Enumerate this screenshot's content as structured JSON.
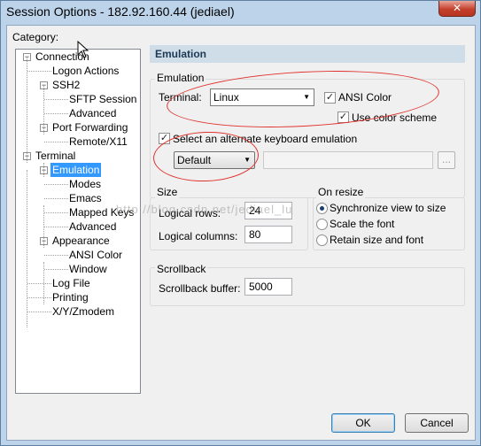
{
  "window": {
    "title": "Session Options - 182.92.160.44 (jediael)",
    "close_glyph": "✕"
  },
  "category_label": "Category:",
  "tree": [
    {
      "label": "Connection",
      "expander": "−"
    },
    {
      "label": "Logon Actions"
    },
    {
      "label": "SSH2",
      "expander": "−"
    },
    {
      "label": "SFTP Session"
    },
    {
      "label": "Advanced"
    },
    {
      "label": "Port Forwarding",
      "expander": "−"
    },
    {
      "label": "Remote/X11"
    },
    {
      "label": "Terminal",
      "expander": "−"
    },
    {
      "label": "Emulation",
      "expander": "−",
      "selected": true
    },
    {
      "label": "Modes"
    },
    {
      "label": "Emacs"
    },
    {
      "label": "Mapped Keys"
    },
    {
      "label": "Advanced"
    },
    {
      "label": "Appearance",
      "expander": "−"
    },
    {
      "label": "ANSI Color"
    },
    {
      "label": "Window"
    },
    {
      "label": "Log File"
    },
    {
      "label": "Printing"
    },
    {
      "label": "X/Y/Zmodem"
    }
  ],
  "pane_title": "Emulation",
  "emulation_group": {
    "label": "Emulation",
    "terminal_label": "Terminal:",
    "terminal_value": "Linux",
    "ansi_color_label": "ANSI Color",
    "ansi_color_checked": true,
    "use_color_scheme_label": "Use color scheme",
    "use_color_scheme_checked": true,
    "alt_keyboard_label": "Select an alternate keyboard emulation",
    "alt_keyboard_checked": true,
    "alt_keyboard_value": "Default",
    "browse_label": "..."
  },
  "size_group": {
    "label": "Size",
    "rows_label": "Logical rows:",
    "rows_value": "24",
    "cols_label": "Logical columns:",
    "cols_value": "80"
  },
  "resize_group": {
    "label": "On resize",
    "options": [
      {
        "label": "Synchronize view to size",
        "selected": true
      },
      {
        "label": "Scale the font",
        "selected": false
      },
      {
        "label": "Retain size and font",
        "selected": false
      }
    ]
  },
  "scrollback_group": {
    "label": "Scrollback",
    "buffer_label": "Scrollback buffer:",
    "buffer_value": "5000"
  },
  "buttons": {
    "ok": "OK",
    "cancel": "Cancel"
  },
  "watermark": "http://blog.csdn.net/jediael_lu",
  "colors": {
    "selection": "#3399ff",
    "annotation": "#e0322d",
    "header_bg": "#cfdde9"
  },
  "icons": {
    "check": "✓",
    "dropdown": "▼"
  }
}
